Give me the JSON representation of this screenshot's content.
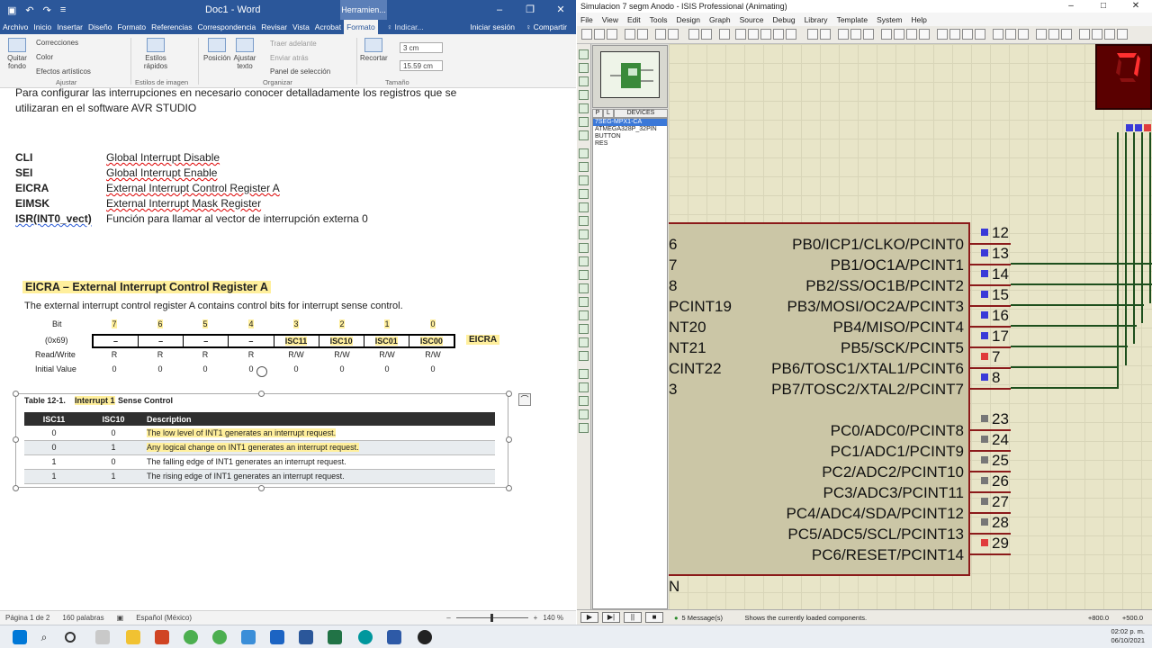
{
  "word": {
    "title": "Doc1 - Word",
    "context_tab": "Herramien...",
    "quick_access": [
      "↶",
      "↷",
      "≡"
    ],
    "tabs": [
      "Archivo",
      "Inicio",
      "Insertar",
      "Diseño",
      "Formato",
      "Referencias",
      "Correspondencia",
      "Revisar",
      "Vista",
      "Acrobat",
      "Formato"
    ],
    "tell_me": "♀ Indicar...",
    "sign_in": "Iniciar sesión",
    "share": "♀ Compartir",
    "ribbon": {
      "quitar_fondo": "Quitar fondo",
      "correcciones": "Correcciones",
      "color": "Color",
      "efectos": "Efectos artísticos",
      "ajustar_group": "Ajustar",
      "estilos": "Estilos rápidos",
      "estilos_group": "Estilos de imagen",
      "posicion": "Posición",
      "ajustar_texto": "Ajustar texto",
      "traer": "Traer adelante",
      "enviar": "Enviar atrás",
      "panel": "Panel de selección",
      "organizar_group": "Organizar",
      "recortar": "Recortar",
      "height": "3 cm",
      "width": "15.59 cm",
      "tamano_group": "Tamaño"
    },
    "doc": {
      "intro1": "Para configurar las interrupciones en necesario conocer detalladamente los registros que se",
      "intro2": "utilizaran en el software AVR STUDIO",
      "defs": [
        {
          "key": "CLI",
          "value": "Global Interrupt Disable"
        },
        {
          "key": "SEI",
          "value": "Global Interrupt  Enable"
        },
        {
          "key": "EICRA",
          "value": "External Interrupt Control Register A"
        },
        {
          "key": "EIMSK",
          "value": "External Interrupt Mask Register"
        },
        {
          "key": "ISR(INT0_vect)",
          "value": "Función para llamar al vector de interrupción externa 0"
        }
      ],
      "eicra_heading": "EICRA – External Interrupt Control Register A",
      "eicra_desc": "The external interrupt control register A contains control bits for interrupt sense control.",
      "bit_label": "Bit",
      "addr_label": "(0x69)",
      "rw_label": "Read/Write",
      "init_label": "Initial Value",
      "reg_name": "EICRA",
      "bits": [
        "7",
        "6",
        "5",
        "4",
        "3",
        "2",
        "1",
        "0"
      ],
      "bit_names": [
        "–",
        "–",
        "–",
        "–",
        "ISC11",
        "ISC10",
        "ISC01",
        "ISC00"
      ],
      "rw": [
        "R",
        "R",
        "R",
        "R",
        "R/W",
        "R/W",
        "R/W",
        "R/W"
      ],
      "init": [
        "0",
        "0",
        "0",
        "0",
        "0",
        "0",
        "0",
        "0"
      ],
      "table_caption_a": "Table 12-1.",
      "table_caption_b": "Interrupt 1",
      "table_caption_c": " Sense Control",
      "table_headers": [
        "ISC11",
        "ISC10",
        "Description"
      ],
      "table_rows": [
        {
          "a": "0",
          "b": "0",
          "desc": "The low level of INT1 generates an interrupt request."
        },
        {
          "a": "0",
          "b": "1",
          "desc": "Any logical change on INT1 generates an interrupt request."
        },
        {
          "a": "1",
          "b": "0",
          "desc": "The falling edge of INT1 generates an interrupt request."
        },
        {
          "a": "1",
          "b": "1",
          "desc": "The rising edge of INT1 generates an interrupt request."
        }
      ]
    },
    "status": {
      "page": "Página 1 de 2",
      "words": "160 palabras",
      "lang": "Español (México)",
      "zoom": "140 %"
    }
  },
  "isis": {
    "title": "Simulacion 7 segm Anodo - ISIS Professional (Animating)",
    "menu": [
      "File",
      "View",
      "Edit",
      "Tools",
      "Design",
      "Graph",
      "Source",
      "Debug",
      "Library",
      "Template",
      "System",
      "Help"
    ],
    "dev_tabs": [
      "P",
      "L",
      "DEVICES"
    ],
    "devices": [
      "7SEG-MPX1-CA",
      "ATMEGA328P_32PIN",
      "BUTTON",
      "RES"
    ],
    "pins_b": [
      {
        "label": "PB0/ICP1/CLKO/PCINT0",
        "num": "12",
        "left": "6",
        "color": "#3a3ad8"
      },
      {
        "label": "PB1/OC1A/PCINT1",
        "num": "13",
        "left": "7",
        "color": "#3a3ad8"
      },
      {
        "label": "PB2/SS/OC1B/PCINT2",
        "num": "14",
        "left": "8",
        "color": "#3a3ad8"
      },
      {
        "label": "PB3/MOSI/OC2A/PCINT3",
        "num": "15",
        "left": "PCINT19",
        "color": "#3a3ad8"
      },
      {
        "label": "PB4/MISO/PCINT4",
        "num": "16",
        "left": "NT20",
        "color": "#3a3ad8"
      },
      {
        "label": "PB5/SCK/PCINT5",
        "num": "17",
        "left": "NT21",
        "color": "#3a3ad8"
      },
      {
        "label": "PB6/TOSC1/XTAL1/PCINT6",
        "num": "7",
        "left": "CINT22",
        "color": "#e03c3c"
      },
      {
        "label": "PB7/TOSC2/XTAL2/PCINT7",
        "num": "8",
        "left": "3",
        "color": "#3a3ad8"
      }
    ],
    "pins_c": [
      {
        "label": "PC0/ADC0/PCINT8",
        "num": "23",
        "color": "#777777"
      },
      {
        "label": "PC1/ADC1/PCINT9",
        "num": "24",
        "color": "#777777"
      },
      {
        "label": "PC2/ADC2/PCINT10",
        "num": "25",
        "color": "#777777"
      },
      {
        "label": "PC3/ADC3/PCINT11",
        "num": "26",
        "color": "#777777"
      },
      {
        "label": "PC4/ADC4/SDA/PCINT12",
        "num": "27",
        "color": "#777777"
      },
      {
        "label": "PC5/ADC5/SCL/PCINT13",
        "num": "28",
        "color": "#777777"
      },
      {
        "label": "PC6/RESET/PCINT14",
        "num": "29",
        "color": "#e03c3c"
      }
    ],
    "left_letter": "N",
    "messages": "5 Message(s)",
    "status_text": "Shows the currently loaded components.",
    "coord_x": "+800.0",
    "coord_y": "+500.0"
  },
  "taskbar": {
    "time": "02:02 p. m.",
    "date": "06/10/2021"
  }
}
